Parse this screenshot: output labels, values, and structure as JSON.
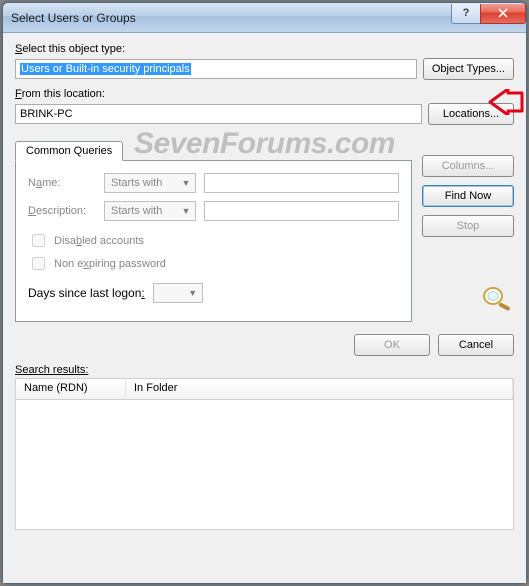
{
  "window": {
    "title": "Select Users or Groups"
  },
  "objectType": {
    "label": "Select this object type:",
    "value": "Users or Built-in security principals",
    "buttonLabel": "Object Types..."
  },
  "location": {
    "label": "From this location:",
    "value": "BRINK-PC",
    "buttonLabel": "Locations..."
  },
  "tabStrip": {
    "tab0": "Common Queries"
  },
  "query": {
    "nameLabel": "Name:",
    "nameCombo": "Starts with",
    "descLabel": "Description:",
    "descCombo": "Starts with",
    "disabledAccounts": "Disabled accounts",
    "nonExpiring": "Non expiring password",
    "daysLabel": "Days since last logon:"
  },
  "sideButtons": {
    "columns": "Columns...",
    "findNow": "Find Now",
    "stop": "Stop"
  },
  "bottomButtons": {
    "ok": "OK",
    "cancel": "Cancel"
  },
  "results": {
    "label": "Search results:",
    "col0": "Name (RDN)",
    "col1": "In Folder"
  },
  "watermark": "SevenForums.com"
}
